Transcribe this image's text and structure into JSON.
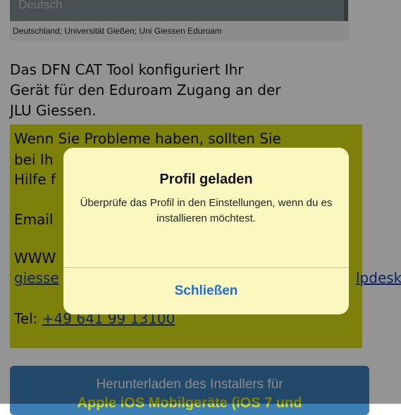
{
  "header": {
    "language_value": "Deutsch",
    "profile_text": "Deutschland; Universität Gießen; Uni Giessen Eduroam"
  },
  "intro": {
    "line1": "Das DFN CAT Tool konfiguriert Ihr",
    "line2": "Gerät für den Eduroam Zugang an der",
    "line3": "JLU Giessen."
  },
  "contact": {
    "line1": "Wenn Sie Probleme haben, sollten Sie",
    "line2_visible": "bei Ih",
    "line3_visible": "Hilfe f",
    "email_label": "Email",
    "www_label": "WWW",
    "link_start": "giesse",
    "link_end": "lpdesk",
    "tel_label": "Tel:",
    "tel_number": "+49 641 99 13100"
  },
  "download": {
    "line1": "Herunterladen des Installers für",
    "line2": "Apple iOS Mobilgeräte (iOS 7 und"
  },
  "alert": {
    "title": "Profil geladen",
    "message": "Überprüfe das Profil in den Einstellungen, wenn du es installieren möchtest.",
    "button": "Schließen"
  },
  "colors": {
    "highlight": "#d8dd14",
    "link": "#1a37a8",
    "alert_bg": "#fbf8bf",
    "alert_button": "#1d6fd6",
    "download_bg": "#3b7fb5"
  }
}
